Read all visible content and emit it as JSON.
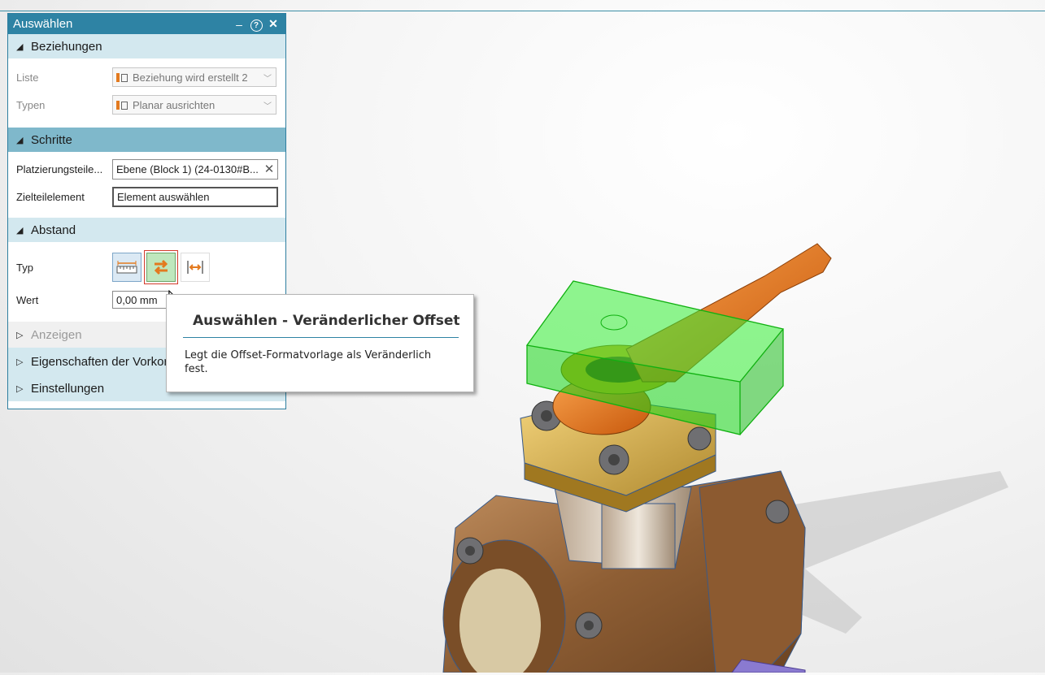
{
  "panel": {
    "title": "Auswählen",
    "controls": {
      "minimize": "–",
      "help": "?",
      "close": "✕"
    },
    "sections": {
      "beziehungen": "Beziehungen",
      "schritte": "Schritte",
      "abstand": "Abstand",
      "anzeigen": "Anzeigen",
      "eigenschaften": "Eigenschaften der Vorkor",
      "einstellungen": "Einstellungen"
    },
    "beziehungen": {
      "liste_label": "Liste",
      "liste_value": "Beziehung wird erstellt 2",
      "typen_label": "Typen",
      "typen_value": "Planar ausrichten"
    },
    "schritte": {
      "platzierung_label": "Platzierungsteile...",
      "platzierung_value": "Ebene (Block 1) (24-0130#B...",
      "ziel_label": "Zielteilelement",
      "ziel_value": "Element auswählen"
    },
    "abstand": {
      "typ_label": "Typ",
      "wert_label": "Wert",
      "wert_value": "0,00 mm"
    }
  },
  "tooltip": {
    "title": "Auswählen - Veränderlicher Offset",
    "description": "Legt die Offset-Formatvorlage als Veränderlich fest."
  },
  "colors": {
    "accent": "#2e83a4",
    "handle": "#e8731c",
    "selection_block": "#22dd22",
    "valve_body": "#9a6a3c"
  }
}
